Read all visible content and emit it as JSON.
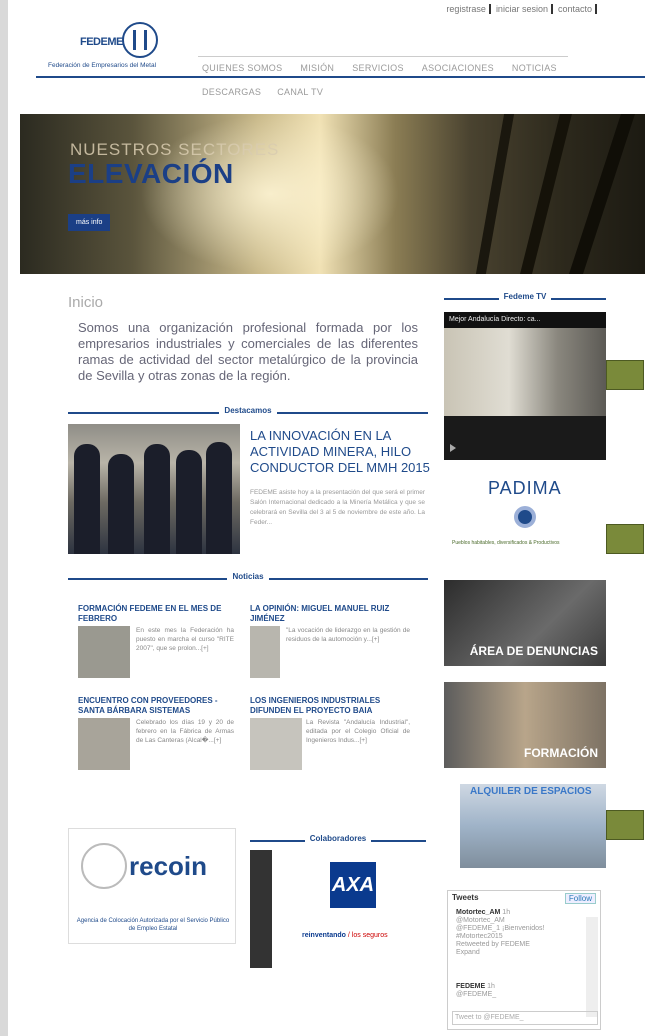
{
  "toplinks": [
    "registrase",
    "iniciar sesion",
    "contacto"
  ],
  "logo": {
    "name": "FEDEME",
    "subtitle": "Federación de Empresarios del Metal"
  },
  "nav": {
    "row1": [
      "QUIENES SOMOS",
      "MISIÓN",
      "SERVICIOS",
      "ASOCIACIONES",
      "NOTICIAS"
    ],
    "row2": [
      "DESCARGAS",
      "CANAL TV"
    ]
  },
  "hero": {
    "kicker": "NUESTROS SECTORES",
    "title": "ELEVACIÓN",
    "button": "más info"
  },
  "main": {
    "heading": "Inicio",
    "intro": "Somos una organización profesional formada por los empresarios industriales y comerciales de las diferentes ramas de actividad del sector metalúrgico de la provincia de Sevilla y otras zonas de la región."
  },
  "destacamos": {
    "label": "Destacamos",
    "title": "LA INNOVACIÓN EN LA ACTIVIDAD MINERA, HILO CONDUCTOR DEL MMH 2015",
    "text": "FEDEME asiste hoy a la presentación del que será el primer Salón Internacional dedicado a la Minería Metálica y que se celebrará en Sevilla del 3 al 5 de noviembre de este año. La Feder..."
  },
  "noticias": {
    "label": "Noticias",
    "items": [
      {
        "title": "FORMACIÓN FEDEME EN EL MES DE FEBRERO",
        "text": "En este mes la Federación ha puesto en marcha el curso \"RITE 2007\", que se prolon...[+]"
      },
      {
        "title": "LA OPINIÓN: MIGUEL MANUEL RUIZ JIMÉNEZ",
        "text": "\"La vocación de liderazgo en la gestión de residuos de la automoción y...[+]"
      },
      {
        "title": "ENCUENTRO CON PROVEEDORES - SANTA BÁRBARA SISTEMAS",
        "text": "Celebrado los días 19 y 20 de febrero en la Fábrica de Armas de Las Canteras (Alcal�...[+]"
      },
      {
        "title": "LOS INGENIEROS INDUSTRIALES DIFUNDEN EL PROYECTO BAIA",
        "text": "La Revista \"Andalucía Industrial\", editada por el Colegio Oficial de Ingenieros Indus...[+]"
      }
    ]
  },
  "colaboradores": {
    "label": "Colaboradores",
    "axa_caption_a": "reinventando",
    "axa_caption_b": "/ los seguros",
    "axa": "AXA"
  },
  "recoin": {
    "name": "recoin",
    "caption": "Agencia de Colocación Autorizada por el Servicio Público de Empleo Estatal"
  },
  "sidebar": {
    "tv_label": "Fedeme TV",
    "video_title": "Mejor Andalucía Directo: ca...",
    "padima": "PADIMA",
    "padima_caption": "Pueblos habitables, diversificados & Productivos",
    "denuncias": "ÁREA DE DENUNCIAS",
    "formacion": "FORMACIÓN",
    "alquiler": "ALQUILER DE ESPACIOS"
  },
  "tweets": {
    "header": "Tweets",
    "follow": "Follow",
    "t1_user": "Motortec_AM",
    "t1_handle": "@Motortec_AM",
    "t1_time": "1h",
    "t1_text": "@FEDEME_1 ¡Bienvenidos! #Motortec2015",
    "t1_rt": "Retweeted by FEDEME",
    "t1_expand": "Expand",
    "t2_user": "FEDEME",
    "t2_handle": "@FEDEME_",
    "t2_time": "1h",
    "input_placeholder": "Tweet to @FEDEME_"
  }
}
